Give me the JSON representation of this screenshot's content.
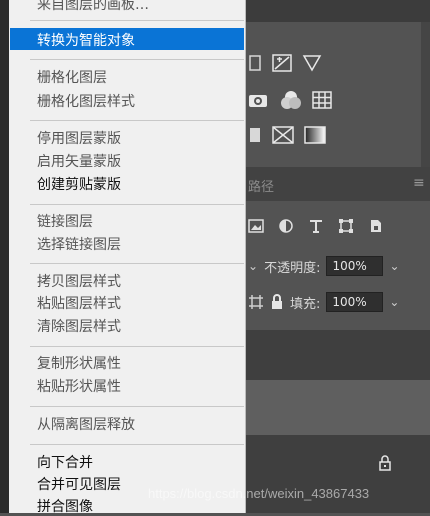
{
  "menu": {
    "top_partial": "来自图层的画板…",
    "highlighted": "转换为智能对象",
    "group_raster": [
      "栅格化图层",
      "栅格化图层样式"
    ],
    "group_mask": [
      "停用图层蒙版",
      "启用矢量蒙版",
      "创建剪贴蒙版"
    ],
    "group_link": [
      "链接图层",
      "选择链接图层"
    ],
    "group_style": [
      "拷贝图层样式",
      "粘贴图层样式",
      "清除图层样式"
    ],
    "group_shape": [
      "复制形状属性",
      "粘贴形状属性"
    ],
    "isolate": "从隔离图层释放",
    "group_merge": [
      "向下合并",
      "合并可见图层",
      "拼合图像"
    ]
  },
  "panel": {
    "tab_label": "路径",
    "opacity_label": "不透明度:",
    "opacity_value": "100%",
    "fill_label": "填充:",
    "fill_value": "100%"
  },
  "watermark": "https://blog.csdn.net/weixin_43867433",
  "colors": {
    "menu_bg": "#f0f0f0",
    "highlight": "#0a74d6",
    "panel_bg": "#535353"
  }
}
